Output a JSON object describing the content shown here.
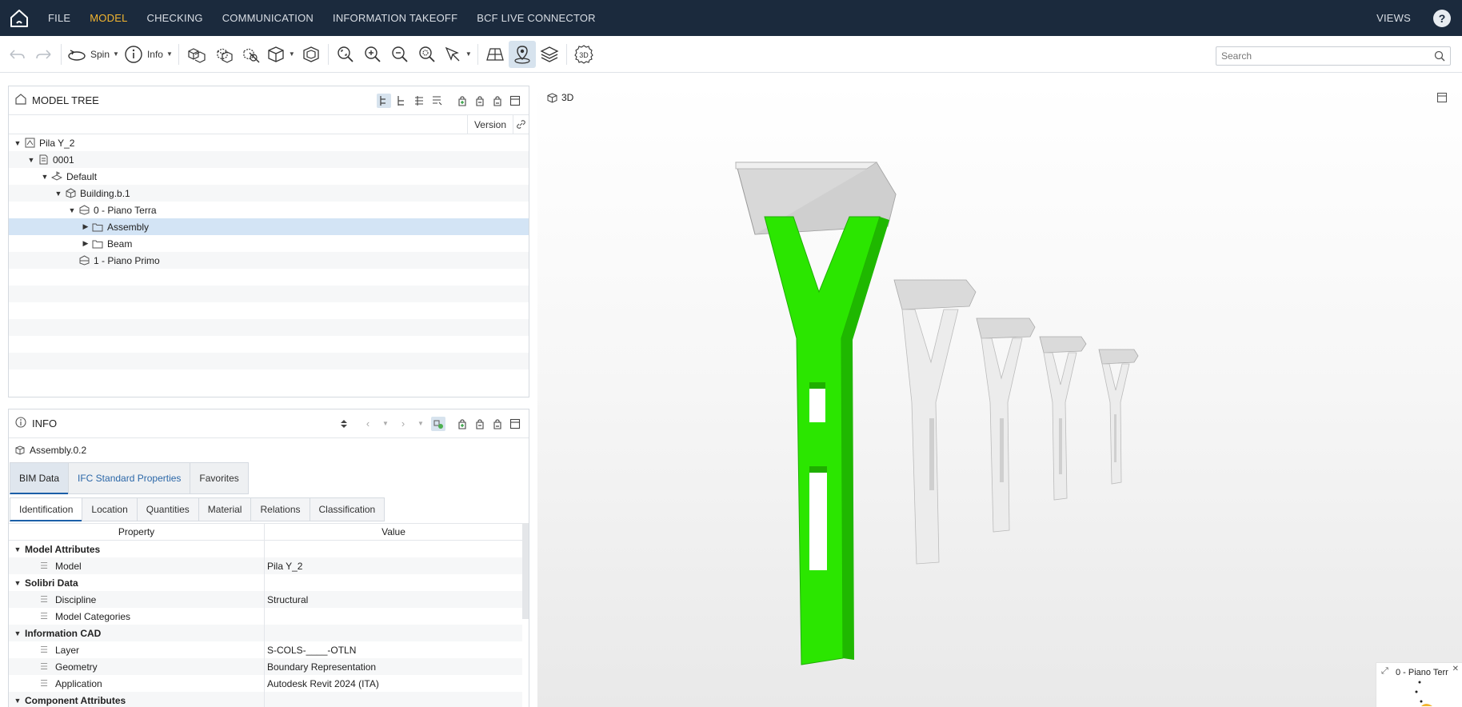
{
  "menu": {
    "items": [
      "FILE",
      "MODEL",
      "CHECKING",
      "COMMUNICATION",
      "INFORMATION TAKEOFF",
      "BCF LIVE CONNECTOR"
    ],
    "views_label": "VIEWS",
    "help_label": "?"
  },
  "toolbar": {
    "spin_label": "Spin",
    "info_label": "Info",
    "view3d_label": "3D",
    "search_placeholder": "Search"
  },
  "model_tree": {
    "title": "MODEL TREE",
    "version_col": "Version",
    "rows": [
      {
        "label": "Pila Y_2",
        "indent": 0,
        "arrow": "down",
        "icon": "model-icon"
      },
      {
        "label": "0001",
        "indent": 1,
        "arrow": "down",
        "icon": "document-icon"
      },
      {
        "label": "Default",
        "indent": 2,
        "arrow": "down",
        "icon": "site-icon"
      },
      {
        "label": "Building.b.1",
        "indent": 3,
        "arrow": "down",
        "icon": "building-icon"
      },
      {
        "label": "0 - Piano Terra",
        "indent": 4,
        "arrow": "down",
        "icon": "storey-icon"
      },
      {
        "label": "Assembly",
        "indent": 5,
        "arrow": "right",
        "icon": "folder-icon",
        "selected": true
      },
      {
        "label": "Beam",
        "indent": 5,
        "arrow": "right",
        "icon": "folder-icon"
      },
      {
        "label": "1 - Piano Primo",
        "indent": 4,
        "arrow": "",
        "icon": "storey-icon"
      }
    ]
  },
  "info": {
    "title": "INFO",
    "selected_name": "Assembly.0.2",
    "tabs_top": [
      "BIM Data",
      "IFC Standard Properties",
      "Favorites"
    ],
    "tabs_sub": [
      "Identification",
      "Location",
      "Quantities",
      "Material",
      "Relations",
      "Classification"
    ],
    "col_property": "Property",
    "col_value": "Value",
    "rows": [
      {
        "group": true,
        "property": "Model Attributes",
        "value": ""
      },
      {
        "group": false,
        "property": "Model",
        "value": "Pila Y_2"
      },
      {
        "group": true,
        "property": "Solibri Data",
        "value": ""
      },
      {
        "group": false,
        "property": "Discipline",
        "value": "Structural"
      },
      {
        "group": false,
        "property": "Model Categories",
        "value": ""
      },
      {
        "group": true,
        "property": "Information CAD",
        "value": ""
      },
      {
        "group": false,
        "property": "Layer",
        "value": "S-COLS-____-OTLN"
      },
      {
        "group": false,
        "property": "Geometry",
        "value": "Boundary Representation"
      },
      {
        "group": false,
        "property": "Application",
        "value": "Autodesk Revit 2024 (ITA)"
      },
      {
        "group": true,
        "property": "Component Attributes",
        "value": ""
      }
    ]
  },
  "view3d": {
    "label": "3D",
    "minimap_label": "0 - Piano Terr",
    "highlight_color": "#22e000"
  }
}
